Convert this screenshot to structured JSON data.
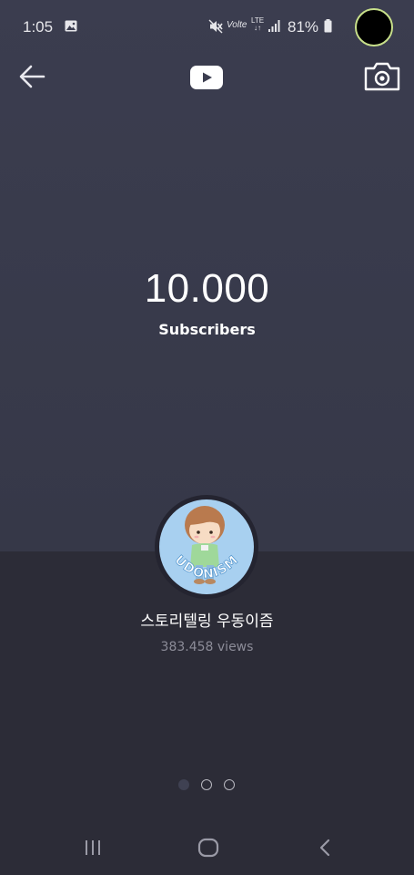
{
  "status_bar": {
    "time": "1:05",
    "volte_label": "Volte",
    "lte_label": "LTE",
    "battery_percent": "81%"
  },
  "toolbar": {
    "back_icon": "arrow-left-icon",
    "logo_icon": "youtube-logo-icon",
    "camera_icon": "camera-icon"
  },
  "milestone": {
    "count": "10.000",
    "label": "Subscribers"
  },
  "channel": {
    "name": "스토리텔링 우동이즘",
    "views": "383.458 views",
    "avatar_text": "UDONISM"
  },
  "pager": {
    "pages": 3,
    "active_index": 0
  },
  "colors": {
    "top_background": "#3b3d4f",
    "bottom_background": "#2c2c37",
    "muted_text": "#8c8c98",
    "avatar_bg": "#a8d0f0"
  }
}
